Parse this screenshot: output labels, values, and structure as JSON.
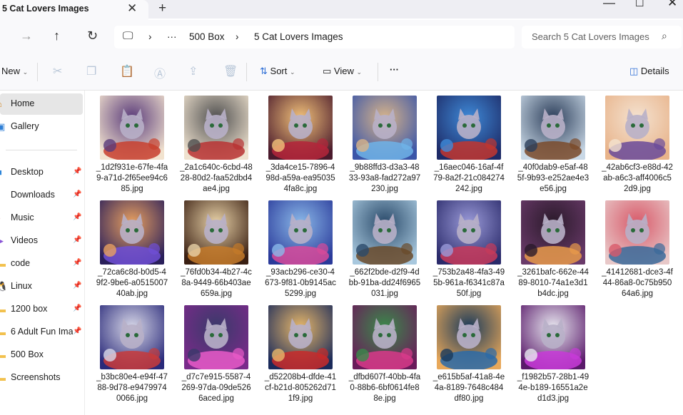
{
  "window": {
    "tab_title": "5 Cat Lovers Images",
    "tab_close_icon": "close-icon",
    "new_tab_icon": "plus-icon"
  },
  "address": {
    "breadcrumb": [
      "500 Box",
      "5 Cat Lovers Images"
    ],
    "overflow": "···",
    "search_placeholder": "Search 5 Cat Lovers Images"
  },
  "toolbar": {
    "new_label": "New",
    "sort_label": "Sort",
    "view_label": "View",
    "more_label": "···",
    "details_label": "Details"
  },
  "sidebar": {
    "items": [
      {
        "label": "Home",
        "icon": "home-icon",
        "color": "#d38a2a",
        "pinned": false
      },
      {
        "label": "Gallery",
        "icon": "gallery-icon",
        "color": "#2f7fd6",
        "pinned": false
      },
      {
        "label": "Desktop",
        "icon": "desktop-icon",
        "color": "#2f86d9",
        "pinned": true
      },
      {
        "label": "Downloads",
        "icon": "download-icon",
        "color": "#2aa06a",
        "pinned": true
      },
      {
        "label": "Music",
        "icon": "music-icon",
        "color": "#d2547a",
        "pinned": true
      },
      {
        "label": "Videos",
        "icon": "video-icon",
        "color": "#8a56d6",
        "pinned": true
      },
      {
        "label": "code",
        "icon": "folder-icon",
        "color": "#f2c14e",
        "pinned": true
      },
      {
        "label": "Linux",
        "icon": "linux-icon",
        "color": "#222222",
        "pinned": true
      },
      {
        "label": "1200 box",
        "icon": "folder-icon",
        "color": "#f2c14e",
        "pinned": true
      },
      {
        "label": "6 Adult Fun Ima",
        "icon": "folder-icon",
        "color": "#f2c14e",
        "pinned": true
      },
      {
        "label": "500 Box",
        "icon": "folder-icon",
        "color": "#f2c14e",
        "pinned": false
      },
      {
        "label": "Screenshots",
        "icon": "folder-icon",
        "color": "#f2c14e",
        "pinned": false
      }
    ]
  },
  "files": [
    {
      "name": "_1d2f931e-67fe-4fa9-a71d-2f65ee94c685.jpg",
      "c1": "#f2e3cf",
      "c2": "#c8402e",
      "c3": "#5a3b7a"
    },
    {
      "name": "_2a1c640c-6cbd-4828-80d2-faa52dbd4ae4.jpg",
      "c1": "#efe2cf",
      "c2": "#b83232",
      "c3": "#4f4f4f"
    },
    {
      "name": "_3da4ce15-7896-498d-a59a-ea950354fa8c.jpg",
      "c1": "#4a1a2c",
      "c2": "#b4253a",
      "c3": "#f2c27a"
    },
    {
      "name": "_9b88ffd3-d3a3-4833-93a8-fad272a97230.jpg",
      "c1": "#3a55a8",
      "c2": "#6fb3e8",
      "c3": "#d8b48a"
    },
    {
      "name": "_16aec046-16af-4f79-8a2f-21c084274242.jpg",
      "c1": "#1d2a66",
      "c2": "#c2362f",
      "c3": "#3f8ad8"
    },
    {
      "name": "_40f0dab9-e5af-485f-9b93-e252ae4e3e56.jpg",
      "c1": "#c9d8e6",
      "c2": "#7a4a2a",
      "c3": "#2c3e5a"
    },
    {
      "name": "_42ab6cf3-e88d-42ab-a6c3-aff4006c52d9.jpg",
      "c1": "#e8b38a",
      "c2": "#6a4a9a",
      "c3": "#f4e2d0"
    },
    {
      "name": "_72ca6c8d-b0d5-49f2-9be6-a051500740ab.jpg",
      "c1": "#2a1f5a",
      "c2": "#6f4fd6",
      "c3": "#e8a060"
    },
    {
      "name": "_76fd0b34-4b27-4c8a-9449-66b403ae659a.jpg",
      "c1": "#3a1f12",
      "c2": "#c47a2a",
      "c3": "#e8d2a8"
    },
    {
      "name": "_93acb296-ce30-4673-9f81-0b9145ac5299.jpg",
      "c1": "#2a3a9a",
      "c2": "#d84a9a",
      "c3": "#8ab8e8"
    },
    {
      "name": "_662f2bde-d2f9-4dbb-91ba-dd24f6965031.jpg",
      "c1": "#a8c8de",
      "c2": "#6a4a2a",
      "c3": "#2a4a6a"
    },
    {
      "name": "_753b2a48-4fa3-495b-961a-f6341c87a50f.jpg",
      "c1": "#2a2a6a",
      "c2": "#c83a5a",
      "c3": "#9a9ad8"
    },
    {
      "name": "_3261bafc-662e-4489-8010-74a1e3d1b4dc.jpg",
      "c1": "#6a3a6a",
      "c2": "#e89a4a",
      "c3": "#2a1a2a"
    },
    {
      "name": "_41412681-dce3-4f44-86a8-0c75b95064a6.jpg",
      "c1": "#e8c8c8",
      "c2": "#3a6a9a",
      "c3": "#d85a6a"
    },
    {
      "name": "_b3bc80e4-e94f-4788-9d78-e94799740066.jpg",
      "c1": "#2a2a7a",
      "c2": "#c83a3a",
      "c3": "#d8d8e8"
    },
    {
      "name": "_d7c7e915-5587-4269-97da-09de5266aced.jpg",
      "c1": "#7a2a8a",
      "c2": "#e85ac8",
      "c3": "#3a3a6a"
    },
    {
      "name": "_d52208b4-dfde-41cf-b21d-805262d711f9.jpg",
      "c1": "#1a2a5a",
      "c2": "#c82a2a",
      "c3": "#e8b86a"
    },
    {
      "name": "_dfbd607f-40bb-4fa0-88b6-6bf0614fe88e.jpg",
      "c1": "#6a1a5a",
      "c2": "#d83a8a",
      "c3": "#3a8a4a"
    },
    {
      "name": "_e615b5af-41a8-4e4a-8189-7648c484df80.jpg",
      "c1": "#e8a85a",
      "c2": "#2a6aa8",
      "c3": "#1a3a5a"
    },
    {
      "name": "_f1982b57-28b1-494e-b189-16551a2ed1d3.jpg",
      "c1": "#5a1a6a",
      "c2": "#c83ad8",
      "c3": "#e8e8f0"
    }
  ]
}
